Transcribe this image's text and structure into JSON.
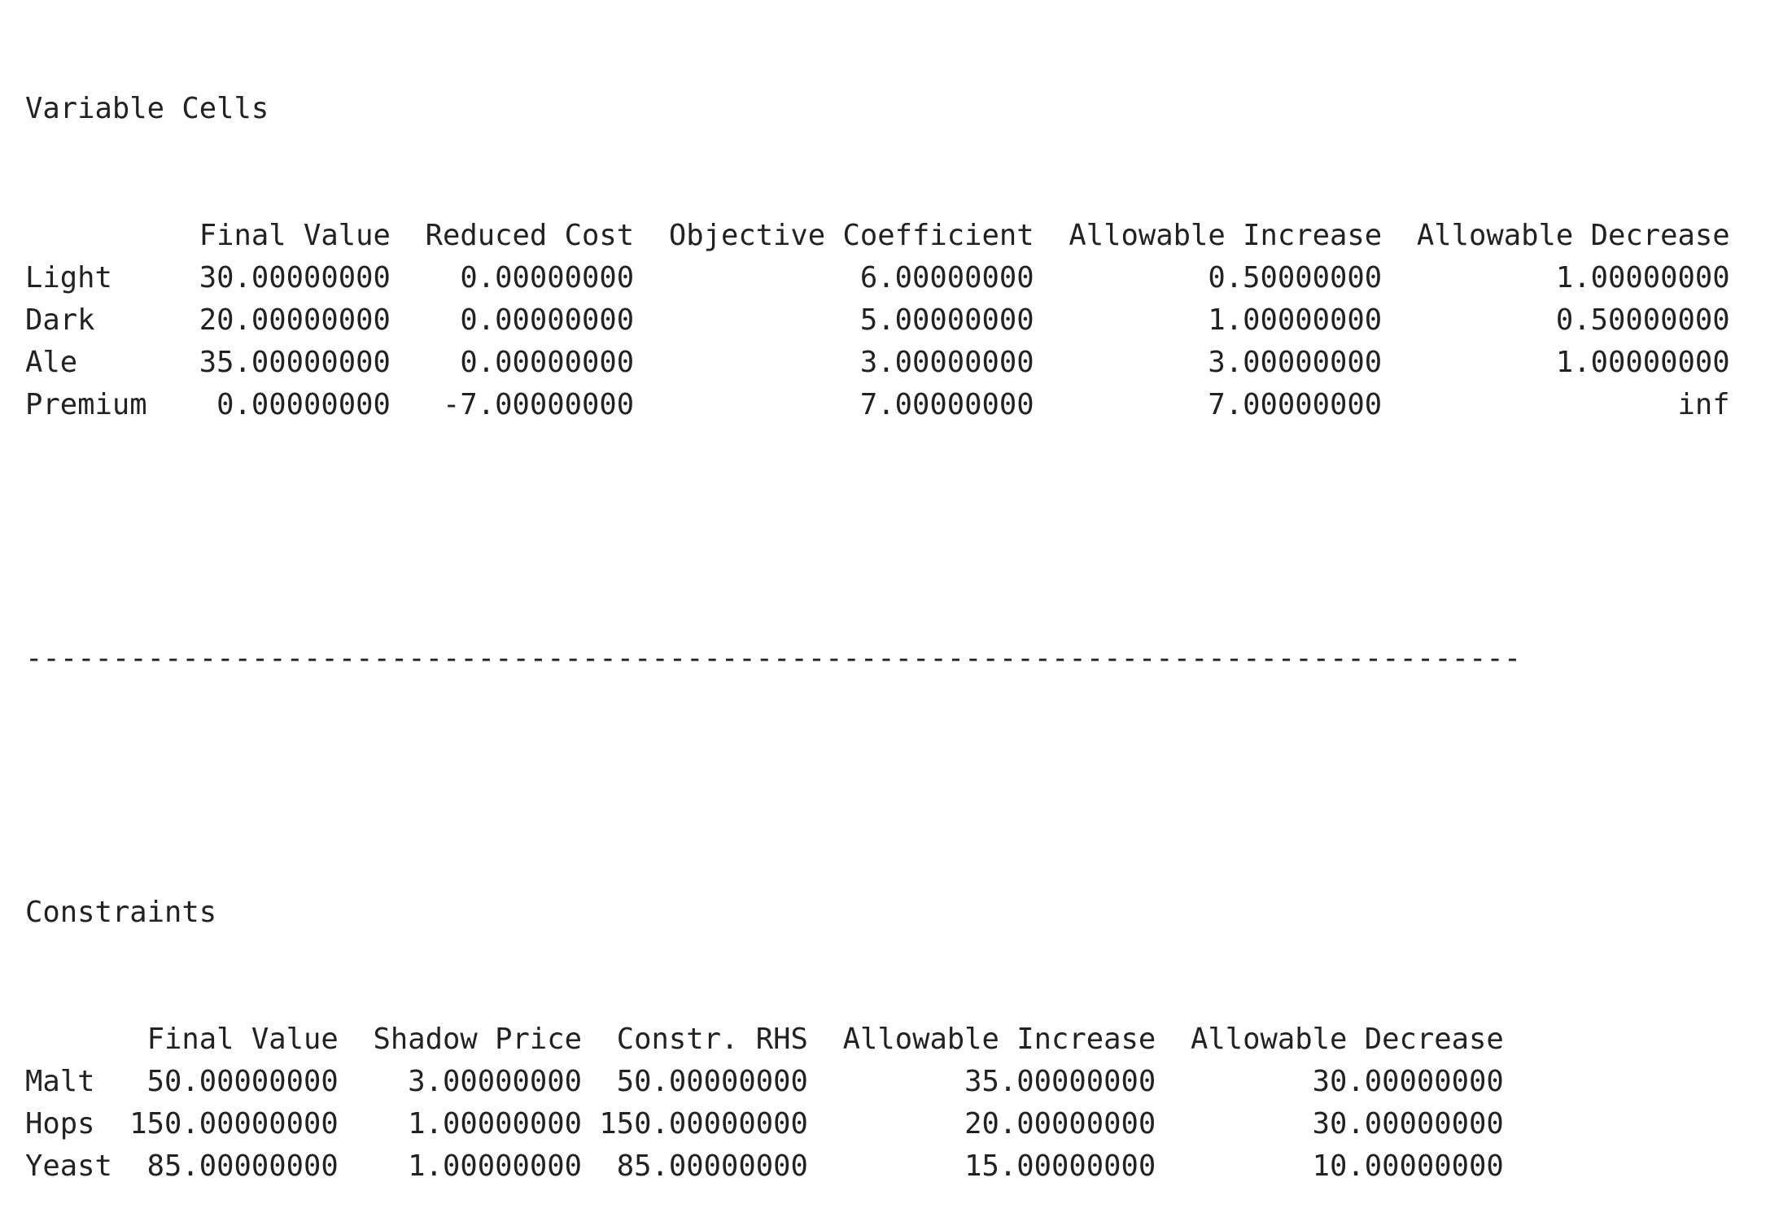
{
  "variable_cells": {
    "title": "Variable Cells",
    "headers": [
      "",
      "Final Value",
      "Reduced Cost",
      "Objective Coefficient",
      "Allowable Increase",
      "Allowable Decrease"
    ],
    "rows": [
      [
        "Light",
        "30.00000000",
        "0.00000000",
        "6.00000000",
        "0.50000000",
        "1.00000000"
      ],
      [
        "Dark",
        "20.00000000",
        "0.00000000",
        "5.00000000",
        "1.00000000",
        "0.50000000"
      ],
      [
        "Ale",
        "35.00000000",
        "0.00000000",
        "3.00000000",
        "3.00000000",
        "1.00000000"
      ],
      [
        "Premium",
        "0.00000000",
        "-7.00000000",
        "7.00000000",
        "7.00000000",
        "inf"
      ]
    ],
    "widths": [
      9,
      11,
      13,
      22,
      19,
      19
    ]
  },
  "separator": "--------------------------------------------------------------------------------------",
  "constraints": {
    "title": "Constraints",
    "headers": [
      "",
      "Final Value",
      "Shadow Price",
      "Constr. RHS",
      "Allowable Increase",
      "Allowable Decrease"
    ],
    "rows": [
      [
        "Malt",
        "50.00000000",
        "3.00000000",
        "50.00000000",
        "35.00000000",
        "30.00000000"
      ],
      [
        "Hops",
        "150.00000000",
        "1.00000000",
        "150.00000000",
        "20.00000000",
        "30.00000000"
      ],
      [
        "Yeast",
        "85.00000000",
        "1.00000000",
        "85.00000000",
        "15.00000000",
        "10.00000000"
      ]
    ],
    "widths": [
      5,
      12,
      13,
      12,
      19,
      19
    ]
  }
}
